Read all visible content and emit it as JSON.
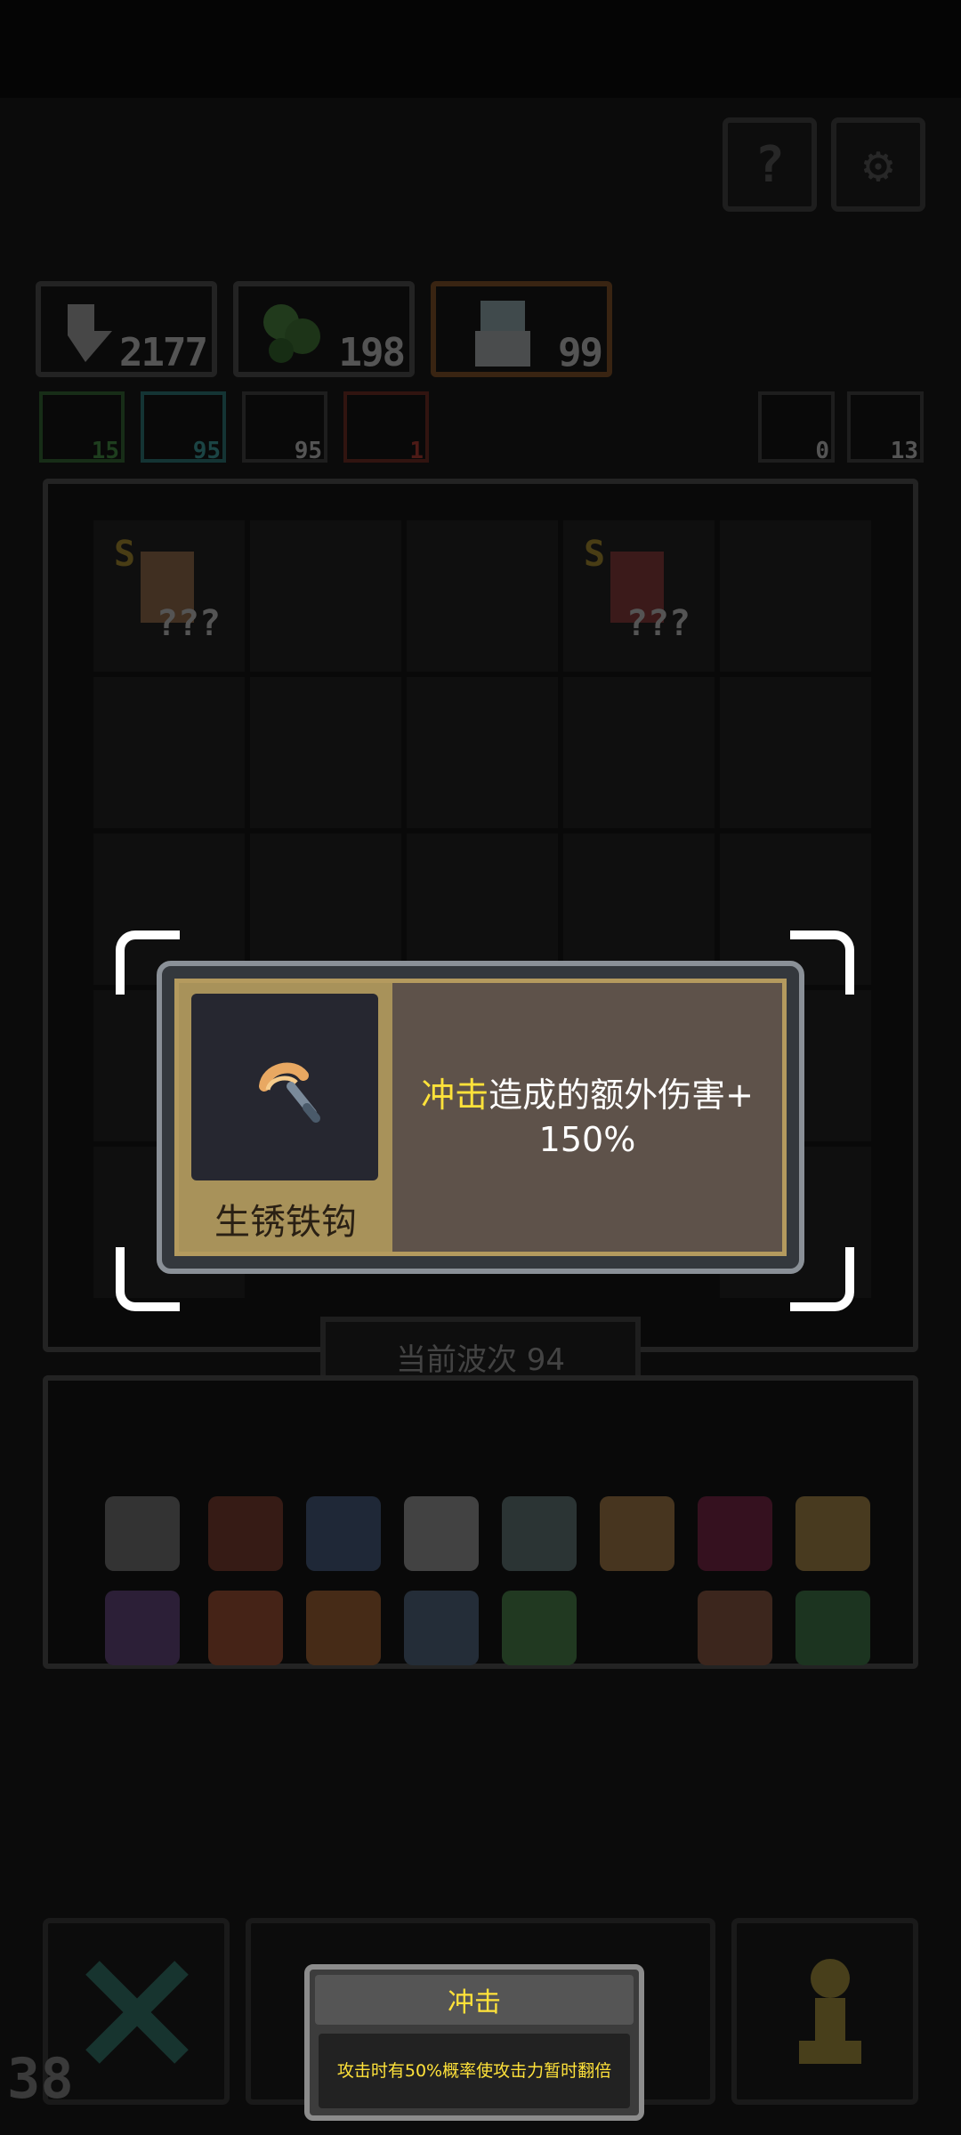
{
  "topbar": {
    "help_icon": "question-icon",
    "settings_icon": "gear-icon"
  },
  "resources": [
    {
      "icon": "sword-icon",
      "value": "2177"
    },
    {
      "icon": "clover-icon",
      "value": "198"
    },
    {
      "icon": "hero-icon",
      "value": "99"
    }
  ],
  "stats": [
    {
      "icon": "green-stat-icon",
      "value": "15",
      "color": "#4fc24f"
    },
    {
      "icon": "cyan-stat-icon",
      "value": "95",
      "color": "#3fd3d3"
    },
    {
      "icon": "sword-stat-icon",
      "value": "95",
      "color": "#ffffff"
    },
    {
      "icon": "red-stat-icon",
      "value": "1",
      "color": "#ff4a3a"
    }
  ],
  "right_stats": [
    {
      "icon": "refresh-icon",
      "value": "0"
    },
    {
      "icon": "bolt-icon",
      "value": "13"
    }
  ],
  "board": {
    "units": [
      {
        "grade": "S",
        "label": "???"
      },
      {
        "grade": "S",
        "label": "???"
      }
    ],
    "wave_label": "当前波次 94"
  },
  "popup": {
    "item_name": "生锈铁钩",
    "item_icon": "rusty-hook-icon",
    "effect_highlight": "冲击",
    "effect_text": "造成的额外伤害+",
    "effect_value": "150%"
  },
  "tooltip": {
    "title": "冲击",
    "description": "攻击时有50%概率使攻击力暂时翻倍"
  },
  "bottom": {
    "left_counter": "38"
  },
  "colors": {
    "accent": "#ffe23a",
    "gold_panel": "#a8925a",
    "popup_bg": "#5e524a"
  }
}
